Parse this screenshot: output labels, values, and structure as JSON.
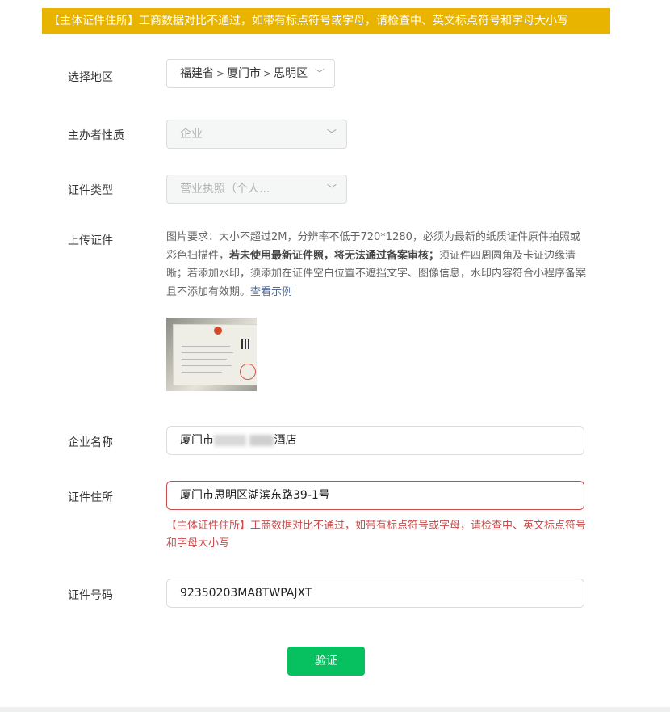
{
  "banner": {
    "text": "【主体证件住所】工商数据对比不通过，如带有标点符号或字母，请检查中、英文标点符号和字母大小写"
  },
  "region": {
    "label": "选择地区",
    "province": "福建省",
    "city": "厦门市",
    "district": "思明区",
    "separator": ">"
  },
  "organizer": {
    "label": "主办者性质",
    "value": "企业"
  },
  "cert_type": {
    "label": "证件类型",
    "value": "营业执照（个人..."
  },
  "upload": {
    "label": "上传证件",
    "desc_a": "图片要求：大小不超过2M，分辨率不低于720*1280，必须为最新的纸质证件原件拍照或彩色扫描件，",
    "desc_bold": "若未使用最新证件照，将无法通过备案审核；",
    "desc_b": "须证件四周圆角及卡证边缘清晰；若添加水印，须添加在证件空白位置不遮挡文字、图像信息，水印内容符合小程序备案且不添加有效期。",
    "example_link": "查看示例"
  },
  "company": {
    "label": "企业名称",
    "value_start": "厦门市",
    "value_end": "酒店"
  },
  "address": {
    "label": "证件住所",
    "value": "厦门市思明区湖滨东路39-1号",
    "error": "【主体证件住所】工商数据对比不通过，如带有标点符号或字母，请检查中、英文标点符号和字母大小写"
  },
  "cert_number": {
    "label": "证件号码",
    "value": "92350203MA8TWPAJXT"
  },
  "verify_button": {
    "label": "验证"
  },
  "colors": {
    "banner": "#e8b400",
    "error": "#c94c4c",
    "primary": "#07c160"
  }
}
